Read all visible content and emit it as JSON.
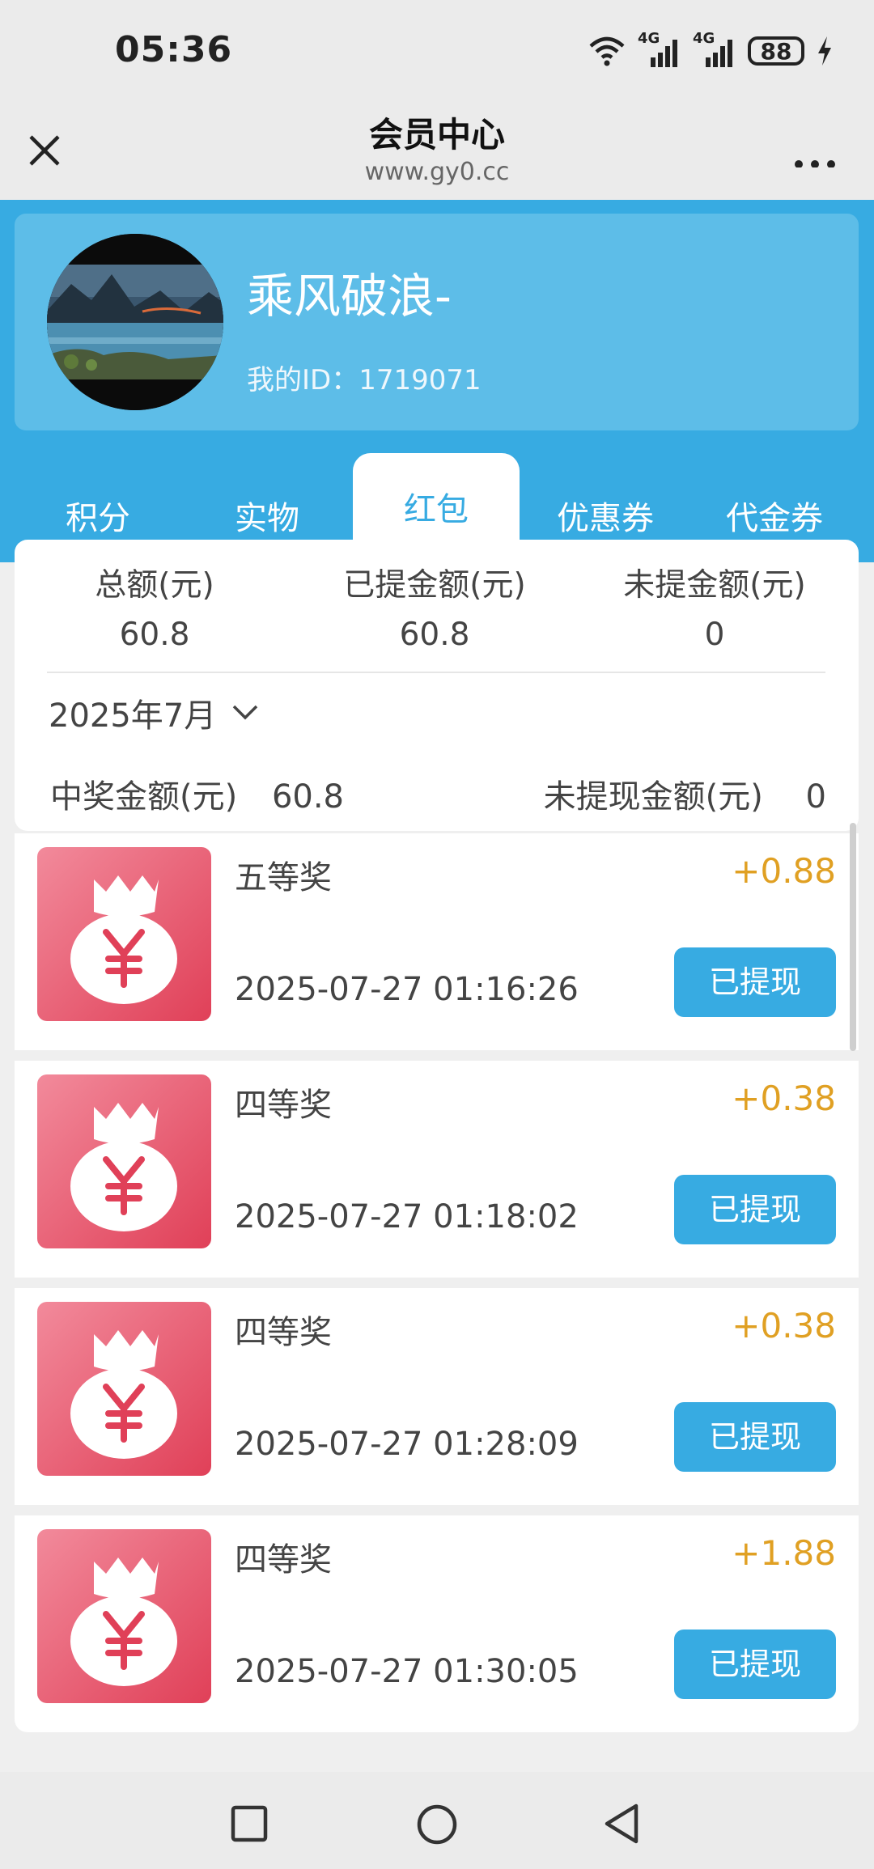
{
  "status_bar": {
    "time": "05:36",
    "network_1": "4G",
    "network_2": "4G",
    "battery": "88",
    "icons": [
      "wifi-icon",
      "signal-icon",
      "signal-icon",
      "battery-icon",
      "charging-icon"
    ]
  },
  "nav": {
    "title": "会员中心",
    "url": "www.gy0.cc",
    "close_icon": "close-icon",
    "more_icon": "more-icon"
  },
  "profile": {
    "username": "乘风破浪-",
    "id_label": "我的ID：",
    "id_value": "1719071"
  },
  "tabs": [
    {
      "label": "积分",
      "active": false
    },
    {
      "label": "实物",
      "active": false
    },
    {
      "label": "红包",
      "active": true
    },
    {
      "label": "优惠券",
      "active": false
    },
    {
      "label": "代金券",
      "active": false
    }
  ],
  "summary": {
    "total_label": "总额(元)",
    "total_value": "60.8",
    "withdrawn_label": "已提金额(元)",
    "withdrawn_value": "60.8",
    "pending_label": "未提金额(元)",
    "pending_value": "0"
  },
  "filter": {
    "month": "2025年7月"
  },
  "stats": {
    "win_label": "中奖金额(元)",
    "win_value": "60.8",
    "unwithdrawn_label": "未提现金额(元)",
    "unwithdrawn_value": "0"
  },
  "records": [
    {
      "prize": "五等奖",
      "amount": "+0.88",
      "time": "2025-07-27 01:16:26",
      "status": "已提现"
    },
    {
      "prize": "四等奖",
      "amount": "+0.38",
      "time": "2025-07-27 01:18:02",
      "status": "已提现"
    },
    {
      "prize": "四等奖",
      "amount": "+0.38",
      "time": "2025-07-27 01:28:09",
      "status": "已提现"
    },
    {
      "prize": "四等奖",
      "amount": "+1.88",
      "time": "2025-07-27 01:30:05",
      "status": "已提现"
    }
  ],
  "colors": {
    "primary": "#37abe2",
    "profile_card": "#5dbde8",
    "amount": "#e0a023",
    "red_packet": "#e04058"
  },
  "system_nav": [
    "recent-apps-icon",
    "home-icon",
    "back-icon"
  ]
}
